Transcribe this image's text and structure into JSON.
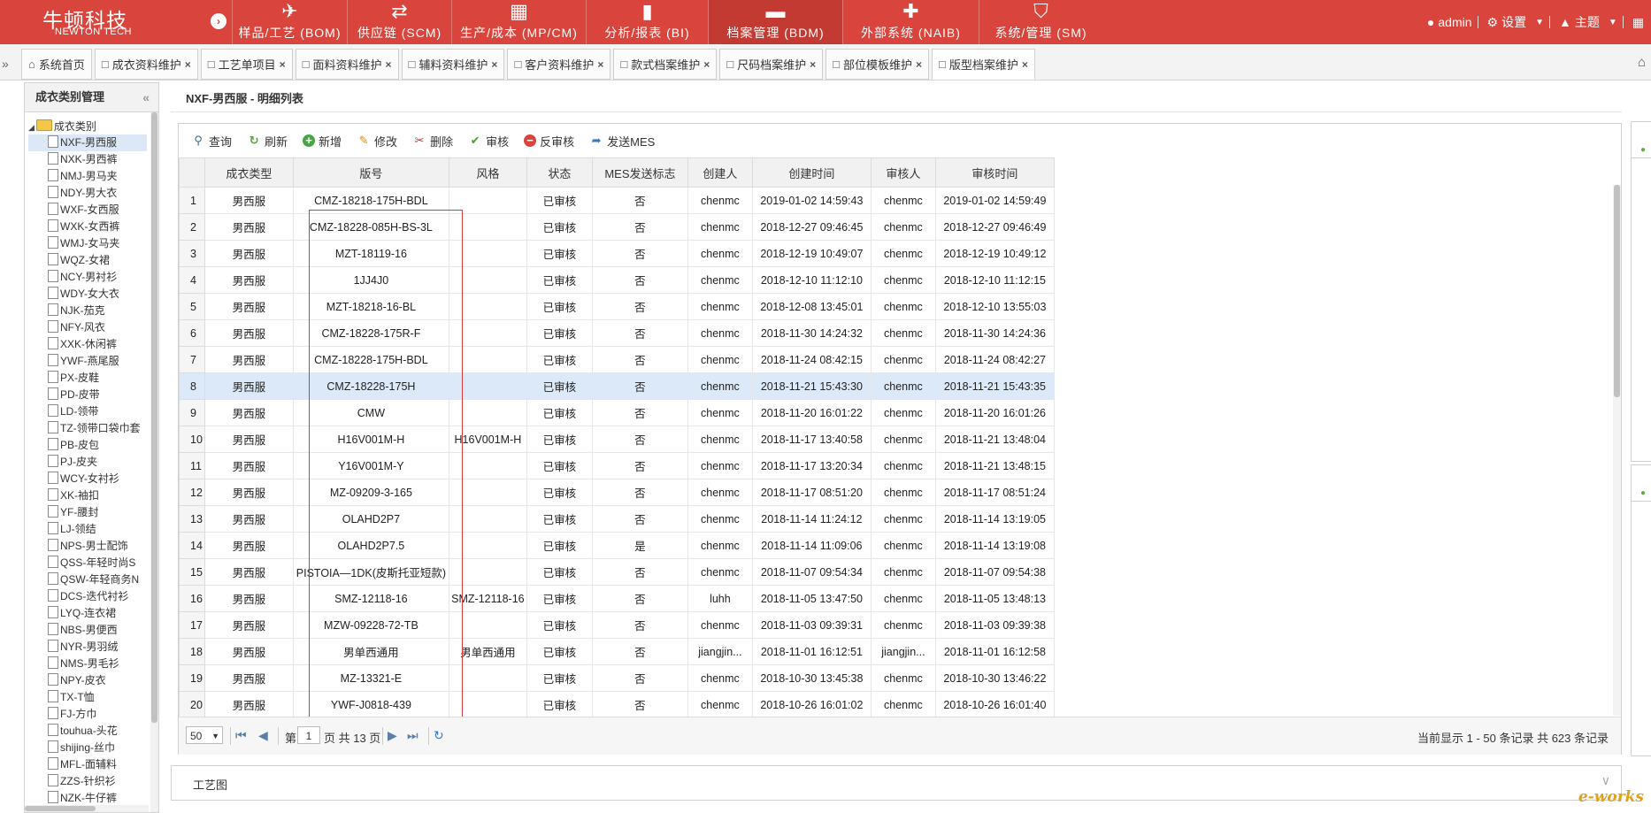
{
  "brand": {
    "name_cn": "牛顿科技",
    "name_en": "NEWTON TECH"
  },
  "modules": [
    {
      "label": "样品/工艺 (BOM)",
      "icon": "paper-plane-icon",
      "glyph": "✈",
      "active": false,
      "width": 130
    },
    {
      "label": "供应链 (SCM)",
      "icon": "exchange-icon",
      "glyph": "⇄",
      "active": false,
      "width": 118
    },
    {
      "label": "生产/成本 (MP/CM)",
      "icon": "calendar-icon",
      "glyph": "▦",
      "active": false,
      "width": 152
    },
    {
      "label": "分析/报表 (BI)",
      "icon": "bar-chart-icon",
      "glyph": "▮",
      "active": false,
      "width": 138
    },
    {
      "label": "档案管理 (BDM)",
      "icon": "folder-icon",
      "glyph": "▬",
      "active": true,
      "width": 152
    },
    {
      "label": "外部系统 (NAIB)",
      "icon": "puzzle-icon",
      "glyph": "✚",
      "active": false,
      "width": 154
    },
    {
      "label": "系统/管理 (SM)",
      "icon": "shield-icon",
      "glyph": "⛉",
      "active": false,
      "width": 140
    }
  ],
  "user": {
    "name": "admin",
    "settings_label": "设置",
    "theme_label": "主题"
  },
  "tabs": [
    {
      "label": "系统首页",
      "closable": false,
      "active": false,
      "icon": "home-icon"
    },
    {
      "label": "成衣资料维护",
      "closable": true,
      "active": false,
      "icon": "file-icon"
    },
    {
      "label": "工艺单项目",
      "closable": true,
      "active": false,
      "icon": "file-icon"
    },
    {
      "label": "面料资料维护",
      "closable": true,
      "active": false,
      "icon": "file-icon"
    },
    {
      "label": "辅料资料维护",
      "closable": true,
      "active": false,
      "icon": "file-icon"
    },
    {
      "label": "客户资料维护",
      "closable": true,
      "active": false,
      "icon": "file-icon"
    },
    {
      "label": "款式档案维护",
      "closable": true,
      "active": false,
      "icon": "file-icon"
    },
    {
      "label": "尺码档案维护",
      "closable": true,
      "active": false,
      "icon": "file-icon"
    },
    {
      "label": "部位模板维护",
      "closable": true,
      "active": false,
      "icon": "file-icon"
    },
    {
      "label": "版型档案维护",
      "closable": true,
      "active": true,
      "icon": "file-icon"
    }
  ],
  "left_panel": {
    "title": "成衣类别管理",
    "root_label": "成衣类别",
    "items": [
      "NXF-男西服",
      "NXK-男西裤",
      "NMJ-男马夹",
      "NDY-男大衣",
      "WXF-女西服",
      "WXK-女西裤",
      "WMJ-女马夹",
      "WQZ-女裙",
      "NCY-男衬衫",
      "WDY-女大衣",
      "NJK-茄克",
      "NFY-风衣",
      "XXK-休闲裤",
      "YWF-燕尾服",
      "PX-皮鞋",
      "PD-皮带",
      "LD-领带",
      "TZ-领带口袋巾套",
      "PB-皮包",
      "PJ-皮夹",
      "WCY-女衬衫",
      "XK-袖扣",
      "YF-腰封",
      "LJ-领结",
      "NPS-男士配饰",
      "QSS-年轻时尚S",
      "QSW-年轻商务N",
      "DCS-迭代衬衫",
      "LYQ-连衣裙",
      "NBS-男便西",
      "NYR-男羽绒",
      "NMS-男毛衫",
      "NPY-皮衣",
      "TX-T恤",
      "FJ-方巾",
      "touhua-头花",
      "shijing-丝巾",
      "MFL-面辅料",
      "ZZS-针织衫",
      "NZK-牛仔裤"
    ],
    "selected_index": 0
  },
  "main": {
    "title": "NXF-男西服 - 明细列表",
    "toolbar": [
      {
        "label": "查询",
        "icon": "search-icon",
        "glyph": "⚲",
        "color": "#3a6ea5"
      },
      {
        "label": "刷新",
        "icon": "refresh-icon",
        "glyph": "↻",
        "color": "#5a9e3a"
      },
      {
        "label": "新增",
        "icon": "add-icon",
        "glyph": "+",
        "color": "#ffffff",
        "bg": "#46a546"
      },
      {
        "label": "修改",
        "icon": "edit-icon",
        "glyph": "✎",
        "color": "#d7891c"
      },
      {
        "label": "删除",
        "icon": "scissors-icon",
        "glyph": "✂",
        "color": "#c0392b"
      },
      {
        "label": "审核",
        "icon": "check-icon",
        "glyph": "✔",
        "color": "#4a9e2a"
      },
      {
        "label": "反审核",
        "icon": "minus-circle-icon",
        "glyph": "−",
        "color": "#ffffff",
        "bg": "#d9453c"
      },
      {
        "label": "发送MES",
        "icon": "share-icon",
        "glyph": "➦",
        "color": "#3a78c3"
      }
    ],
    "columns": [
      "",
      "成衣类型",
      "版号",
      "风格",
      "状态",
      "MES发送标志",
      "创建人",
      "创建时间",
      "审核人",
      "审核时间"
    ],
    "rows": [
      [
        "1",
        "男西服",
        "CMZ-18218-175H-BDL",
        "",
        "已审核",
        "否",
        "chenmc",
        "2019-01-02 14:59:43",
        "chenmc",
        "2019-01-02 14:59:49"
      ],
      [
        "2",
        "男西服",
        "CMZ-18228-085H-BS-3L",
        "",
        "已审核",
        "否",
        "chenmc",
        "2018-12-27 09:46:45",
        "chenmc",
        "2018-12-27 09:46:49"
      ],
      [
        "3",
        "男西服",
        "MZT-18119-16",
        "",
        "已审核",
        "否",
        "chenmc",
        "2018-12-19 10:49:07",
        "chenmc",
        "2018-12-19 10:49:12"
      ],
      [
        "4",
        "男西服",
        "1JJ4J0",
        "",
        "已审核",
        "否",
        "chenmc",
        "2018-12-10 11:12:10",
        "chenmc",
        "2018-12-10 11:12:15"
      ],
      [
        "5",
        "男西服",
        "MZT-18218-16-BL",
        "",
        "已审核",
        "否",
        "chenmc",
        "2018-12-08 13:45:01",
        "chenmc",
        "2018-12-10 13:55:03"
      ],
      [
        "6",
        "男西服",
        "CMZ-18228-175R-F",
        "",
        "已审核",
        "否",
        "chenmc",
        "2018-11-30 14:24:32",
        "chenmc",
        "2018-11-30 14:24:36"
      ],
      [
        "7",
        "男西服",
        "CMZ-18228-175H-BDL",
        "",
        "已审核",
        "否",
        "chenmc",
        "2018-11-24 08:42:15",
        "chenmc",
        "2018-11-24 08:42:27"
      ],
      [
        "8",
        "男西服",
        "CMZ-18228-175H",
        "",
        "已审核",
        "否",
        "chenmc",
        "2018-11-21 15:43:30",
        "chenmc",
        "2018-11-21 15:43:35"
      ],
      [
        "9",
        "男西服",
        "CMW",
        "",
        "已审核",
        "否",
        "chenmc",
        "2018-11-20 16:01:22",
        "chenmc",
        "2018-11-20 16:01:26"
      ],
      [
        "10",
        "男西服",
        "H16V001M-H",
        "H16V001M-H",
        "已审核",
        "否",
        "chenmc",
        "2018-11-17 13:40:58",
        "chenmc",
        "2018-11-21 13:48:04"
      ],
      [
        "11",
        "男西服",
        "Y16V001M-Y",
        "",
        "已审核",
        "否",
        "chenmc",
        "2018-11-17 13:20:34",
        "chenmc",
        "2018-11-21 13:48:15"
      ],
      [
        "12",
        "男西服",
        "MZ-09209-3-165",
        "",
        "已审核",
        "否",
        "chenmc",
        "2018-11-17 08:51:20",
        "chenmc",
        "2018-11-17 08:51:24"
      ],
      [
        "13",
        "男西服",
        "OLAHD2P7",
        "",
        "已审核",
        "否",
        "chenmc",
        "2018-11-14 11:24:12",
        "chenmc",
        "2018-11-14 13:19:05"
      ],
      [
        "14",
        "男西服",
        "OLAHD2P7.5",
        "",
        "已审核",
        "是",
        "chenmc",
        "2018-11-14 11:09:06",
        "chenmc",
        "2018-11-14 13:19:08"
      ],
      [
        "15",
        "男西服",
        "PISTOIA—1DK(皮斯托亚短款)",
        "",
        "已审核",
        "否",
        "chenmc",
        "2018-11-07 09:54:34",
        "chenmc",
        "2018-11-07 09:54:38"
      ],
      [
        "16",
        "男西服",
        "SMZ-12118-16",
        "SMZ-12118-16",
        "已审核",
        "否",
        "luhh",
        "2018-11-05 13:47:50",
        "chenmc",
        "2018-11-05 13:48:13"
      ],
      [
        "17",
        "男西服",
        "MZW-09228-72-TB",
        "",
        "已审核",
        "否",
        "chenmc",
        "2018-11-03 09:39:31",
        "chenmc",
        "2018-11-03 09:39:38"
      ],
      [
        "18",
        "男西服",
        "男单西通用",
        "男单西通用",
        "已审核",
        "否",
        "jiangjin...",
        "2018-11-01 16:12:51",
        "jiangjin...",
        "2018-11-01 16:12:58"
      ],
      [
        "19",
        "男西服",
        "MZ-13321-E",
        "",
        "已审核",
        "否",
        "chenmc",
        "2018-10-30 13:45:38",
        "chenmc",
        "2018-10-30 13:46:22"
      ],
      [
        "20",
        "男西服",
        "YWF-J0818-439",
        "",
        "已审核",
        "否",
        "chenmc",
        "2018-10-26 16:01:02",
        "chenmc",
        "2018-10-26 16:01:40"
      ]
    ],
    "selected_row": 7,
    "pager": {
      "page_size": "50",
      "page_prefix": "第",
      "current_page": "1",
      "page_suffix": "页 共 13 页",
      "info": "当前显示 1 - 50 条记录 共 623 条记录"
    }
  },
  "process_panel": {
    "title": "工艺图"
  },
  "watermark": "e-works",
  "colors": {
    "brand_red": "#d9453c",
    "active_module": "#c23a32",
    "selected_row": "#dce9f9",
    "highlight_box": "#d43a3a"
  }
}
